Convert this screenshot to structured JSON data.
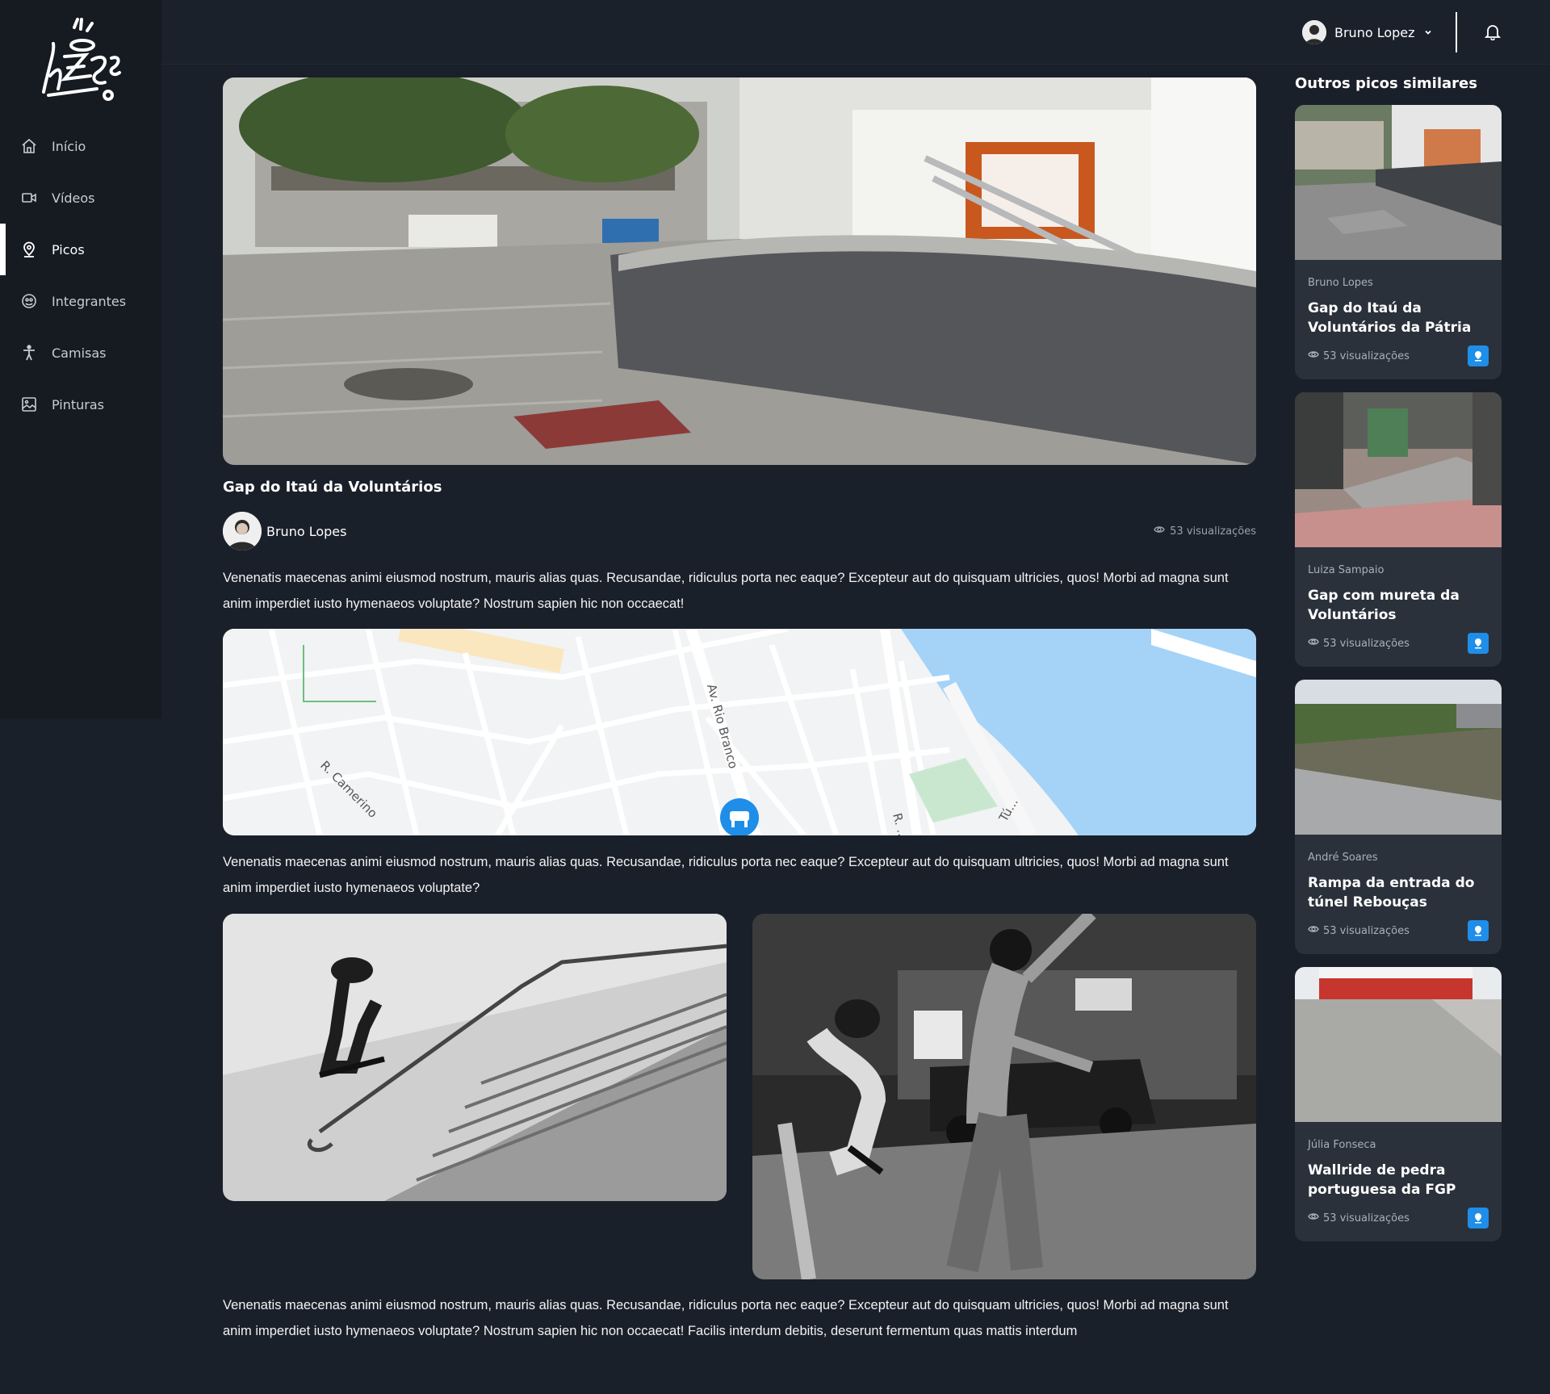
{
  "sidebar": {
    "items": [
      {
        "label": "Início",
        "icon": "home-icon"
      },
      {
        "label": "Vídeos",
        "icon": "video-icon"
      },
      {
        "label": "Picos",
        "icon": "map-pin-icon"
      },
      {
        "label": "Integrantes",
        "icon": "users-icon"
      },
      {
        "label": "Camisas",
        "icon": "person-icon"
      },
      {
        "label": "Pinturas",
        "icon": "image-icon"
      }
    ],
    "active": "Picos"
  },
  "header": {
    "user_name": "Bruno Lopez"
  },
  "spot": {
    "title": "Gap do Itaú da Voluntários",
    "author": "Bruno Lopes",
    "views": "53 visualizações",
    "paragraph_1": "Venenatis maecenas animi eiusmod nostrum, mauris alias quas. Recusandae, ridiculus porta nec eaque? Excepteur aut do quisquam ultricies, quos! Morbi ad magna sunt anim imperdiet iusto hymenaeos voluptate? Nostrum sapien hic non occaecat!",
    "paragraph_2": "Venenatis maecenas animi eiusmod nostrum, mauris alias quas. Recusandae, ridiculus porta nec eaque? Excepteur aut do quisquam ultricies, quos! Morbi ad magna sunt anim imperdiet iusto hymenaeos voluptate?",
    "paragraph_3": "Venenatis maecenas animi eiusmod nostrum, mauris alias quas. Recusandae, ridiculus porta nec eaque? Excepteur aut do quisquam ultricies, quos! Morbi ad magna sunt anim imperdiet iusto hymenaeos voluptate? Nostrum sapien hic non occaecat! Facilis interdum debitis, deserunt fermentum quas mattis interdum"
  },
  "map": {
    "street_labels": [
      "Av. Rio Branco",
      "R. Camerino",
      "R. ...",
      "Tú..."
    ]
  },
  "aside": {
    "title": "Outros picos similares",
    "cards": [
      {
        "author": "Bruno Lopes",
        "title": "Gap do Itaú da Voluntários da Pátria",
        "views": "53 visualizações"
      },
      {
        "author": "Luiza Sampaio",
        "title": "Gap com mureta da Voluntários",
        "views": "53 visualizações"
      },
      {
        "author": "André Soares",
        "title": "Rampa da entrada do túnel Rebouças",
        "views": "53 visualizações"
      },
      {
        "author": "Júlia Fonseca",
        "title": "Wallride de pedra portuguesa da FGP",
        "views": "53 visualizações"
      }
    ]
  },
  "colors": {
    "background": "#1a202a",
    "sidebar": "#161a21",
    "card": "#2a313b",
    "accent": "#1e8ee9"
  }
}
